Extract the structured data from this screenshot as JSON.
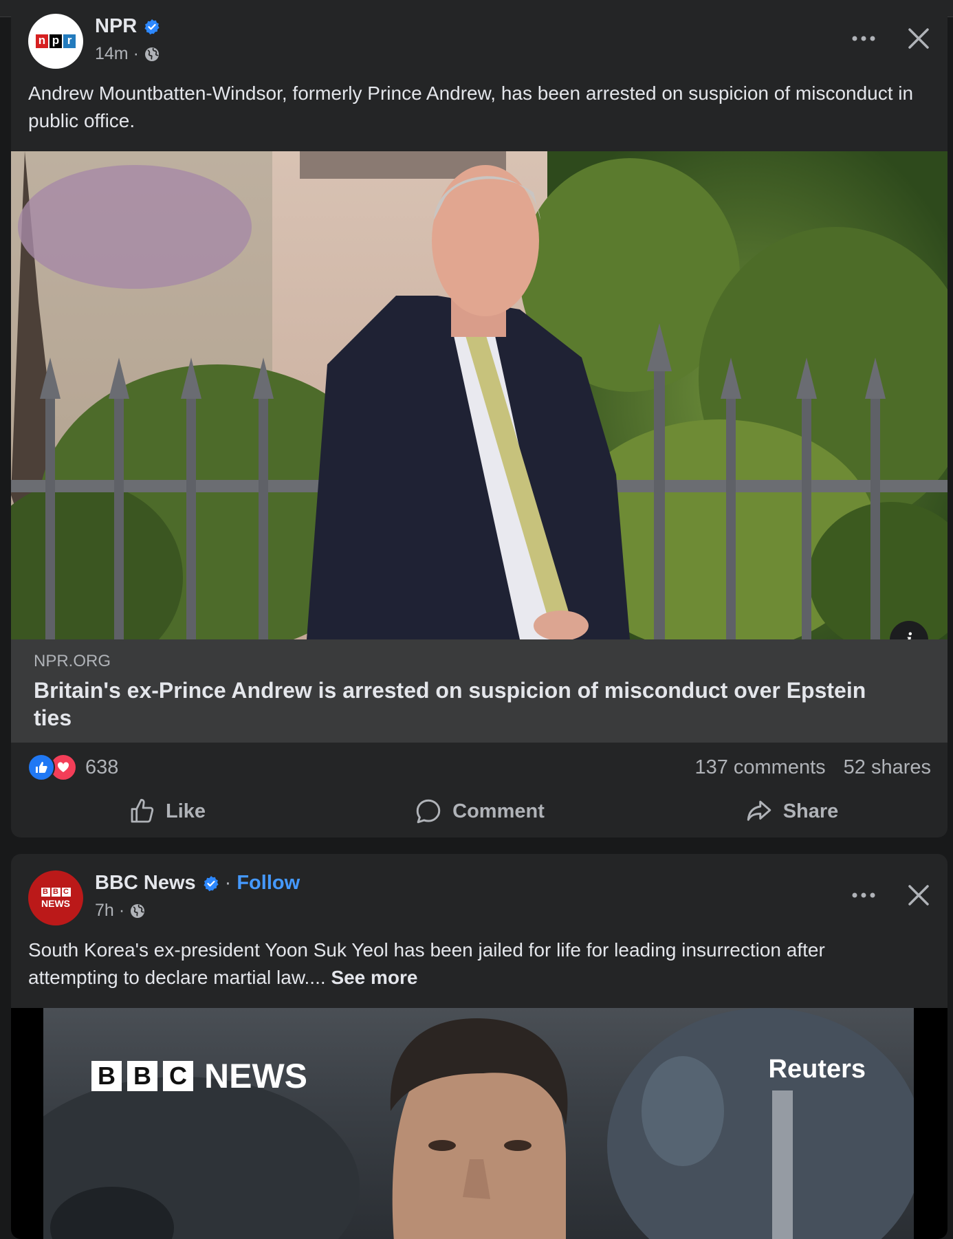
{
  "posts": [
    {
      "page_name": "NPR",
      "avatar_letters": [
        "n",
        "p",
        "r"
      ],
      "verified": true,
      "time": "14m",
      "audience_icon": "globe-icon",
      "text": "Andrew Mountbatten-Windsor, formerly Prince Andrew, has been arrested on suspicion of misconduct in public office.",
      "link": {
        "domain": "NPR.ORG",
        "title": "Britain's ex-Prince Andrew is arrested on suspicion of misconduct over Epstein ties",
        "info_label": "i"
      },
      "reaction_count": "638",
      "comments": "137 comments",
      "shares": "52 shares",
      "actions": {
        "like": "Like",
        "comment": "Comment",
        "share": "Share"
      }
    },
    {
      "page_name": "BBC News",
      "avatar_letters": [
        "B",
        "B",
        "C"
      ],
      "avatar_word": "NEWS",
      "verified": true,
      "separator": "·",
      "follow": "Follow",
      "time": "7h",
      "audience_icon": "globe-icon",
      "text": "South Korea's ex-president Yoon Suk Yeol has been jailed for life for leading insurrection after attempting to declare martial law....",
      "see_more": "See more",
      "image_overlay": {
        "logo_letters": [
          "B",
          "B",
          "C"
        ],
        "logo_word": "NEWS",
        "credit": "Reuters"
      }
    }
  ],
  "meta_dot": "·",
  "colors": {
    "background": "#18191a",
    "card": "#242526",
    "link_box": "#3a3b3c",
    "accent_blue": "#2d88ff",
    "follow_blue": "#4599ff",
    "npr_red": "#d62021",
    "npr_black": "#000000",
    "npr_blue": "#237bbd",
    "bbc_red": "#bb1919",
    "like_blue": "#2078f4",
    "love_red": "#f33e58"
  }
}
